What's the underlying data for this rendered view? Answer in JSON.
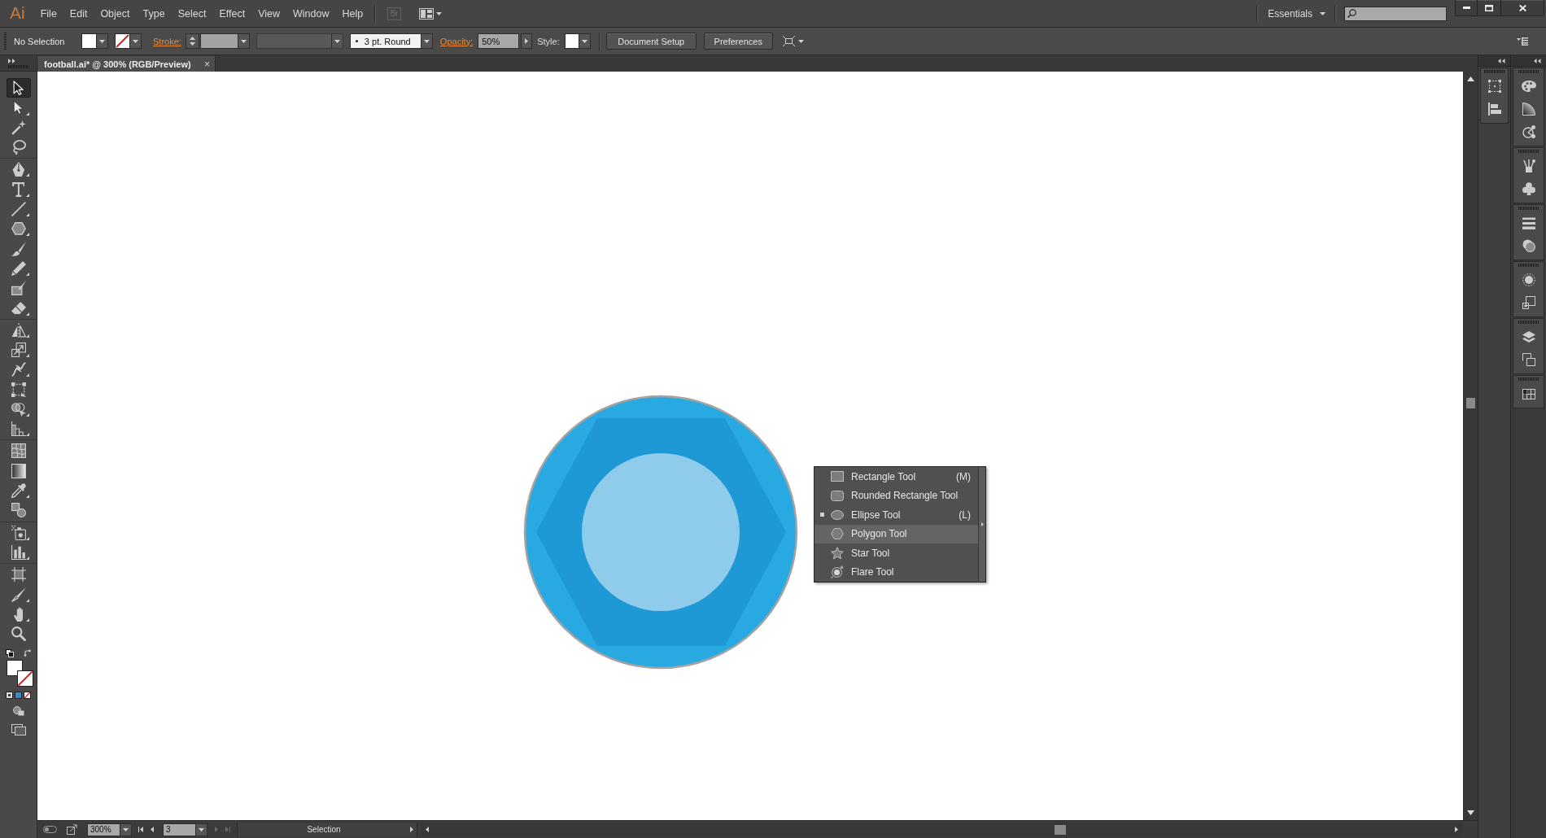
{
  "menu_bar": {
    "logo": "Ai",
    "menus": [
      "File",
      "Edit",
      "Object",
      "Type",
      "Select",
      "Effect",
      "View",
      "Window",
      "Help"
    ],
    "bridge_button": "Br",
    "workspace": "Essentials"
  },
  "control_bar": {
    "selection": "No Selection",
    "stroke_label": "Stroke:",
    "width_profile": {
      "disabled": true
    },
    "brush": "3 pt. Round",
    "opacity_label": "Opacity:",
    "opacity": "50%",
    "style_label": "Style:",
    "buttons": [
      "Document Setup",
      "Preferences"
    ]
  },
  "document_tab": {
    "title": "football.ai* @ 300% (RGB/Preview)",
    "close": "×"
  },
  "tool_groups": [
    {
      "tools": [
        {
          "selected": true,
          "flyout": false
        },
        {
          "selected": false,
          "flyout": true
        },
        {
          "selected": false,
          "flyout": false
        },
        {
          "selected": false,
          "flyout": false
        }
      ]
    },
    {
      "tools": [
        {
          "selected": false,
          "flyout": true
        },
        {
          "selected": false,
          "flyout": true
        },
        {
          "selected": false,
          "flyout": true
        },
        {
          "selected": false,
          "flyout": true
        },
        {
          "selected": false,
          "flyout": false
        },
        {
          "selected": false,
          "flyout": true
        },
        {
          "selected": false,
          "flyout": false
        },
        {
          "selected": false,
          "flyout": true
        }
      ]
    },
    {
      "tools": [
        {
          "selected": false,
          "flyout": true
        },
        {
          "selected": false,
          "flyout": true
        },
        {
          "selected": false,
          "flyout": true
        },
        {
          "selected": false,
          "flyout": false
        },
        {
          "selected": false,
          "flyout": true
        },
        {
          "selected": false,
          "flyout": true
        }
      ]
    },
    {
      "tools": [
        {
          "selected": false,
          "flyout": false
        },
        {
          "selected": false,
          "flyout": false
        },
        {
          "selected": false,
          "flyout": true
        },
        {
          "selected": false,
          "flyout": false
        }
      ]
    },
    {
      "tools": [
        {
          "selected": false,
          "flyout": true
        },
        {
          "selected": false,
          "flyout": true
        }
      ]
    },
    {
      "tools": [
        {
          "selected": false,
          "flyout": false
        },
        {
          "selected": false,
          "flyout": true
        },
        {
          "selected": false,
          "flyout": true
        },
        {
          "selected": false,
          "flyout": false
        }
      ]
    }
  ],
  "flyout": {
    "items": [
      {
        "label": "Rectangle Tool",
        "shortcut": "(M)",
        "selected": false,
        "hovered": false
      },
      {
        "label": "Rounded Rectangle Tool",
        "selected": false,
        "hovered": false
      },
      {
        "label": "Ellipse Tool",
        "shortcut": "(L)",
        "selected": true,
        "hovered": false
      },
      {
        "label": "Polygon Tool",
        "selected": false,
        "hovered": true
      },
      {
        "label": "Star Tool",
        "selected": false,
        "hovered": false
      },
      {
        "label": "Flare Tool",
        "selected": false,
        "hovered": false
      }
    ]
  },
  "status_bar": {
    "zoom": "300%",
    "artboard": "3",
    "nav": [
      {
        "disabled": false
      },
      {
        "disabled": false
      },
      {
        "disabled": true
      },
      {
        "disabled": true
      }
    ],
    "status": "Selection"
  }
}
